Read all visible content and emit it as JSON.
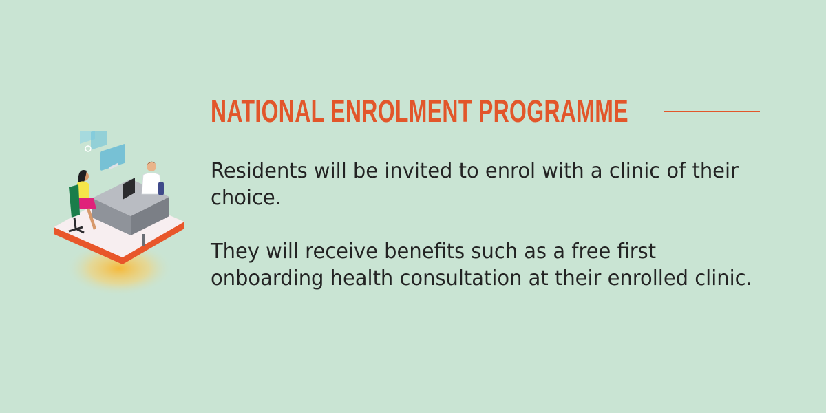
{
  "title": "NATIONAL ENROLMENT PROGRAMME",
  "paragraphs": {
    "first": "Residents will be invited to enrol with a clinic of their choice.",
    "second": "They will receive benefits such as a free first onboarding health consultation at their enrolled clinic."
  },
  "illustration": {
    "icon": "doctor-consultation-illustration",
    "subject": "patient consulting doctor at desk"
  },
  "colors": {
    "background": "#c9e4d3",
    "accent": "#e2562a",
    "text": "#232323"
  }
}
